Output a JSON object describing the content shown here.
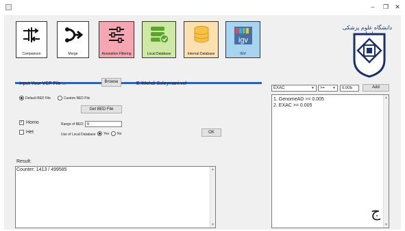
{
  "window": {
    "minimize": "–",
    "restore": "❐",
    "close": "✕"
  },
  "toolbar": [
    {
      "label": "Comparison",
      "icon": "split-arrows-icon",
      "color": "#ffffff"
    },
    {
      "label": "Merge",
      "icon": "merge-arrows-icon",
      "color": "#ffffff"
    },
    {
      "label": "Annotation Filtering",
      "icon": "sliders-icon",
      "color": "#f4a6b3"
    },
    {
      "label": "Local Database",
      "icon": "database-check-icon",
      "color": "#cde9a4"
    },
    {
      "label": "Internal Database",
      "icon": "database-icon",
      "color": "#fde0b0"
    },
    {
      "label": "IGV",
      "icon": "igv-logo-icon",
      "color": "#a8d4ef"
    }
  ],
  "logo": {
    "text": "دانشگاه علوم پزشکی ایران"
  },
  "input": {
    "label": "Input Your VCF File ...",
    "browse": "Browse",
    "path": "E:\\Mehdi Soleymani.vcf",
    "default_bed": "Default BED File",
    "custom_bed": "Custom BED File",
    "get_bed": "Get BED File",
    "homo": "Homo",
    "het": "Het",
    "range_label": "Range of BED:",
    "range_value": "0",
    "local_db_label": "Use of Local Database",
    "yes": "Yes",
    "no": "No",
    "ok": "OK"
  },
  "result": {
    "label": "Result:",
    "text": "Counter: 1413 / 499585"
  },
  "filter": {
    "field": "EXAC",
    "operator": ">=",
    "value": "0.005",
    "add": "Add",
    "items": [
      "1. GenomeAD >= 0.005",
      "2. EXAC >= 0.005"
    ]
  },
  "corner_glyph": "ج"
}
